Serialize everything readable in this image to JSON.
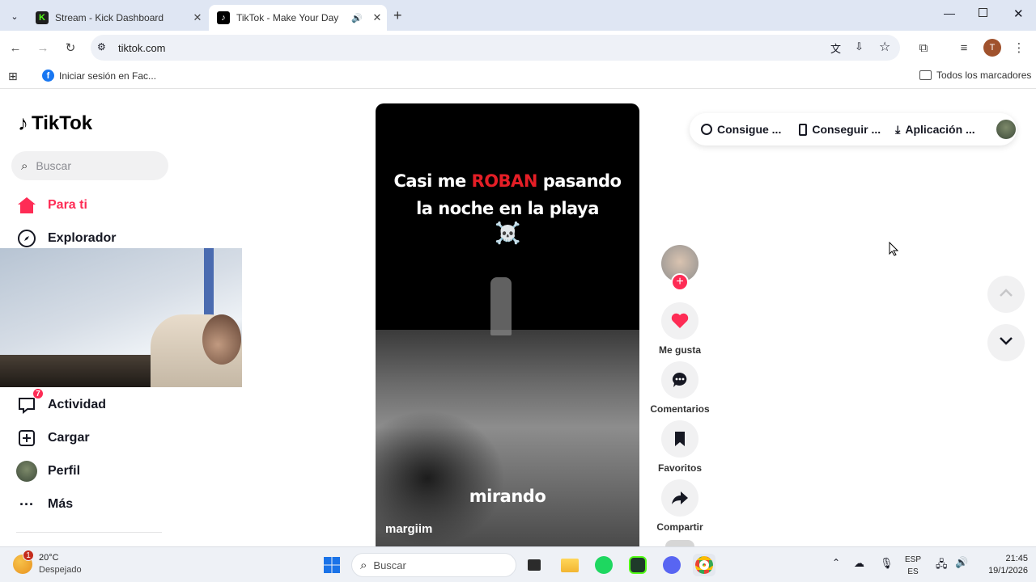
{
  "browser": {
    "tabs": [
      {
        "title": "Stream - Kick Dashboard",
        "favicon": "K"
      },
      {
        "title": "TikTok - Make Your Day",
        "favicon": "♪"
      }
    ],
    "url": "tiktok.com",
    "bookmark": "Iniciar sesión en Fac...",
    "all_bookmarks": "Todos los marcadores",
    "profile_initial": "T"
  },
  "sidebar": {
    "logo": "TikTok",
    "search_placeholder": "Buscar",
    "items": [
      {
        "label": "Para ti"
      },
      {
        "label": "Explorador"
      },
      {
        "label": "Actividad",
        "badge": "7"
      },
      {
        "label": "Cargar"
      },
      {
        "label": "Perfil"
      },
      {
        "label": "Más"
      }
    ]
  },
  "video": {
    "caption_line1_a": "Casi me ",
    "caption_line1_b": "ROBAN",
    "caption_line1_c": " pasando",
    "caption_line2": "la noche en la playa",
    "caption_emoji": "☠️",
    "subtitle": "mirando",
    "author": "margiim"
  },
  "actions": {
    "like": "Me gusta",
    "comments": "Comentarios",
    "favorites": "Favoritos",
    "share": "Compartir"
  },
  "topbar": {
    "item1": "Consigue ...",
    "item2": "Conseguir ...",
    "item3": "Aplicación ..."
  },
  "taskbar": {
    "weather_temp": "20°C",
    "weather_desc": "Despejado",
    "weather_badge": "1",
    "search": "Buscar",
    "lang1": "ESP",
    "lang2": "ES",
    "time": "21:45",
    "date": "19/1/2026"
  },
  "colors": {
    "accent": "#fe2c55",
    "chrome_bg": "#dfe6f3"
  }
}
